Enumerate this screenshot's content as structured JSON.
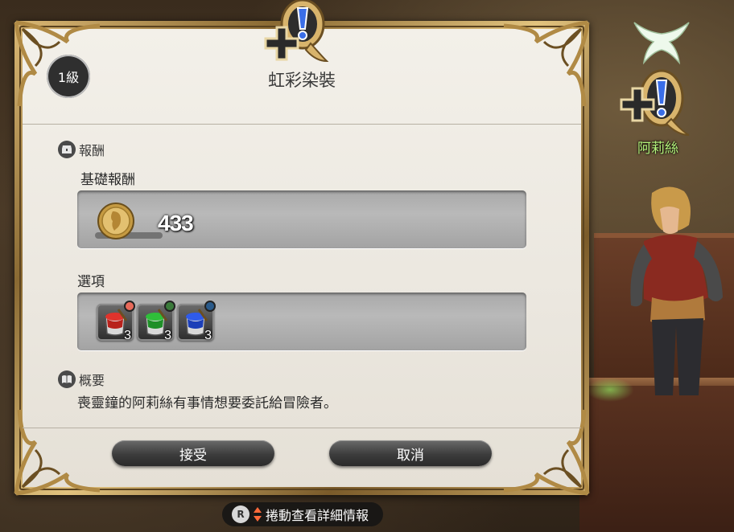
{
  "quest": {
    "level": "1級",
    "title": "虹彩染裝"
  },
  "rewards": {
    "section_label": "報酬",
    "base_label": "基礎報酬",
    "gil_amount": "433",
    "options_label": "選項",
    "options": [
      {
        "icon": "red-dye-pot-icon",
        "quantity": "3",
        "color": "#e0332c"
      },
      {
        "icon": "green-dye-pot-icon",
        "quantity": "3",
        "color": "#2fbf3a"
      },
      {
        "icon": "blue-dye-pot-icon",
        "quantity": "3",
        "color": "#2f5bea"
      }
    ]
  },
  "summary": {
    "section_label": "概要",
    "text": "喪靈鐘的阿莉絲有事情想要委託給冒險者。"
  },
  "buttons": {
    "accept": "接受",
    "cancel": "取消"
  },
  "hint": {
    "button": "R",
    "text": "捲動查看詳細情報"
  },
  "npc": {
    "name": "阿莉絲"
  },
  "colors": {
    "panel": "#eeeae2",
    "frame_gold": "#c9a662",
    "npc_name": "#b6f57c"
  }
}
